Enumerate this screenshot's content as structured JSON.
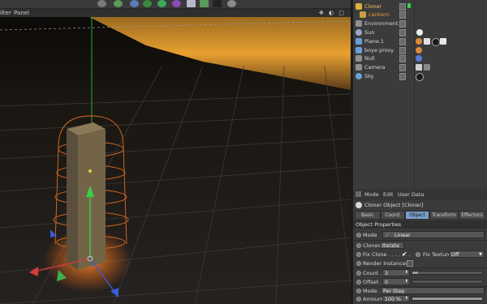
{
  "viewport_menu": {
    "filter": "ilter",
    "panel": "Panel",
    "nav_icons": "✥ ◐ ▢"
  },
  "object_manager": {
    "objects": [
      {
        "name": "Cloner",
        "color": "#e0b040",
        "name_color": "#f0c060"
      },
      {
        "name": "cankern",
        "color": "#c8a040",
        "name_color": "#e89a30"
      },
      {
        "name": "Environment",
        "color": "#909090",
        "name_color": "#d6d6d6"
      },
      {
        "name": "Sun",
        "color": "#9aa8c8",
        "name_color": "#d6d6d6"
      },
      {
        "name": "Plane.1",
        "color": "#6aa0d8",
        "name_color": "#d6d6d6"
      },
      {
        "name": "boye proxy",
        "color": "#6aa0d8",
        "name_color": "#d6d6d6"
      },
      {
        "name": "Null",
        "color": "#909090",
        "name_color": "#d6d6d6"
      },
      {
        "name": "Camera",
        "color": "#909090",
        "name_color": "#d6d6d6"
      },
      {
        "name": "Sky",
        "color": "#6aa0d8",
        "name_color": "#d6d6d6"
      }
    ]
  },
  "attribute_manager": {
    "menu": {
      "mode": "Mode",
      "edit": "Edit",
      "user_data": "User Data"
    },
    "title": "Cloner Object [Cloner]",
    "tabs": [
      "Basic",
      "Coord.",
      "Object",
      "Transform",
      "Effectors"
    ],
    "active_tab": "Object",
    "section": "Object Properties",
    "mode": {
      "label": "Mode",
      "value": "Linear"
    },
    "clones": {
      "label": "Clones",
      "value": "Iterate"
    },
    "fix_clone": {
      "label": "Fix Clone . . . . . . .",
      "checked": "✔"
    },
    "fix_texture": {
      "label": "Fix Texture",
      "value": "Off"
    },
    "render_instances": {
      "label": "Render Instances"
    },
    "count": {
      "label": "Count . . . .",
      "value": "3",
      "level": 0.08
    },
    "offset": {
      "label": "Offset . . . .",
      "value": "0",
      "level": 0.0
    },
    "step_mode": {
      "label": "Mode . . .",
      "value": "Per Step"
    },
    "amount": {
      "label": "Amount",
      "value": "100 %",
      "level": 1.0
    }
  }
}
